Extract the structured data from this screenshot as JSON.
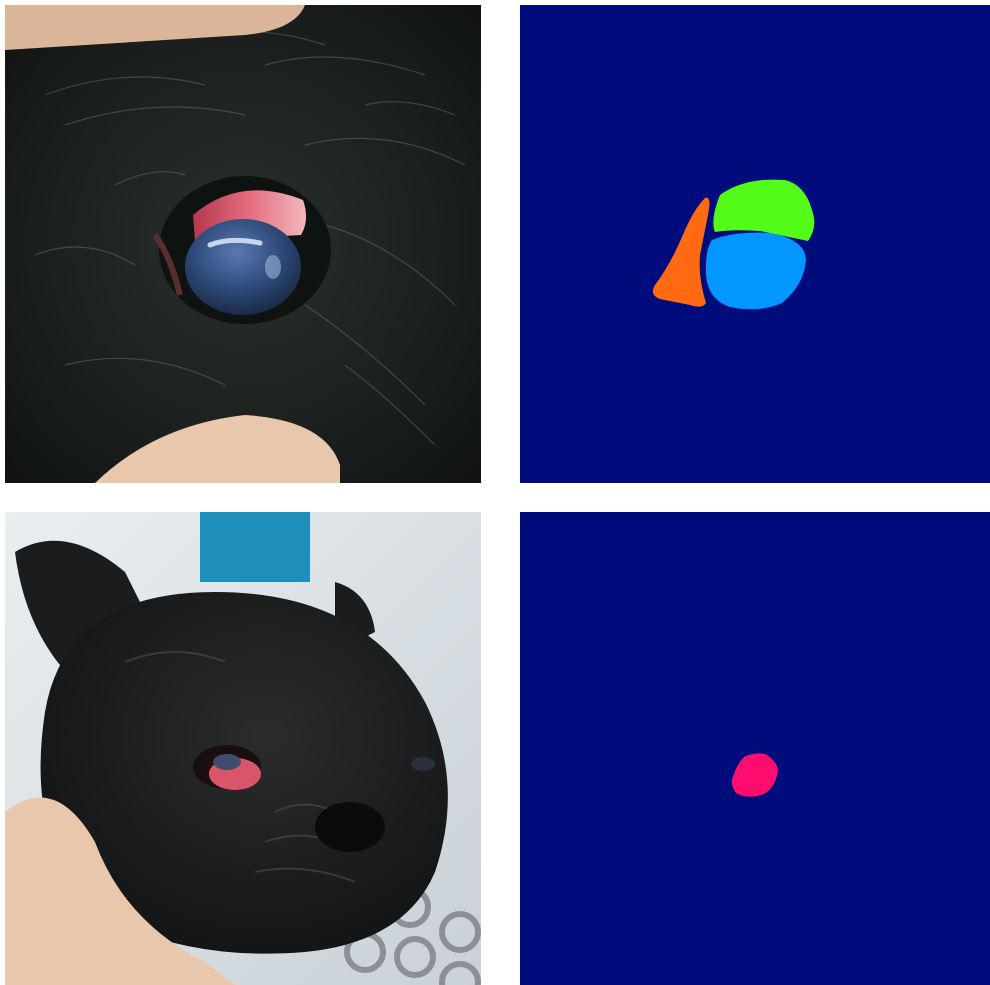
{
  "figure": {
    "panels": [
      {
        "name": "photo-eye-closeup",
        "kind": "photo"
      },
      {
        "name": "segmentation-mask-eye-closeup",
        "kind": "mask"
      },
      {
        "name": "photo-dog-face",
        "kind": "photo"
      },
      {
        "name": "segmentation-mask-dog-face",
        "kind": "mask"
      }
    ]
  },
  "colors": {
    "mask_background": "#000c7b",
    "mask_region_orange": "#ff6a13",
    "mask_region_green": "#52fb18",
    "mask_region_blue": "#0396fe",
    "mask_region_pink": "#ff0d6e",
    "fur_dark": "#1a1e1d",
    "skin": "#e8c7ad",
    "cornea": "#2d4a7a",
    "conjunctiva": "#d9556a"
  }
}
